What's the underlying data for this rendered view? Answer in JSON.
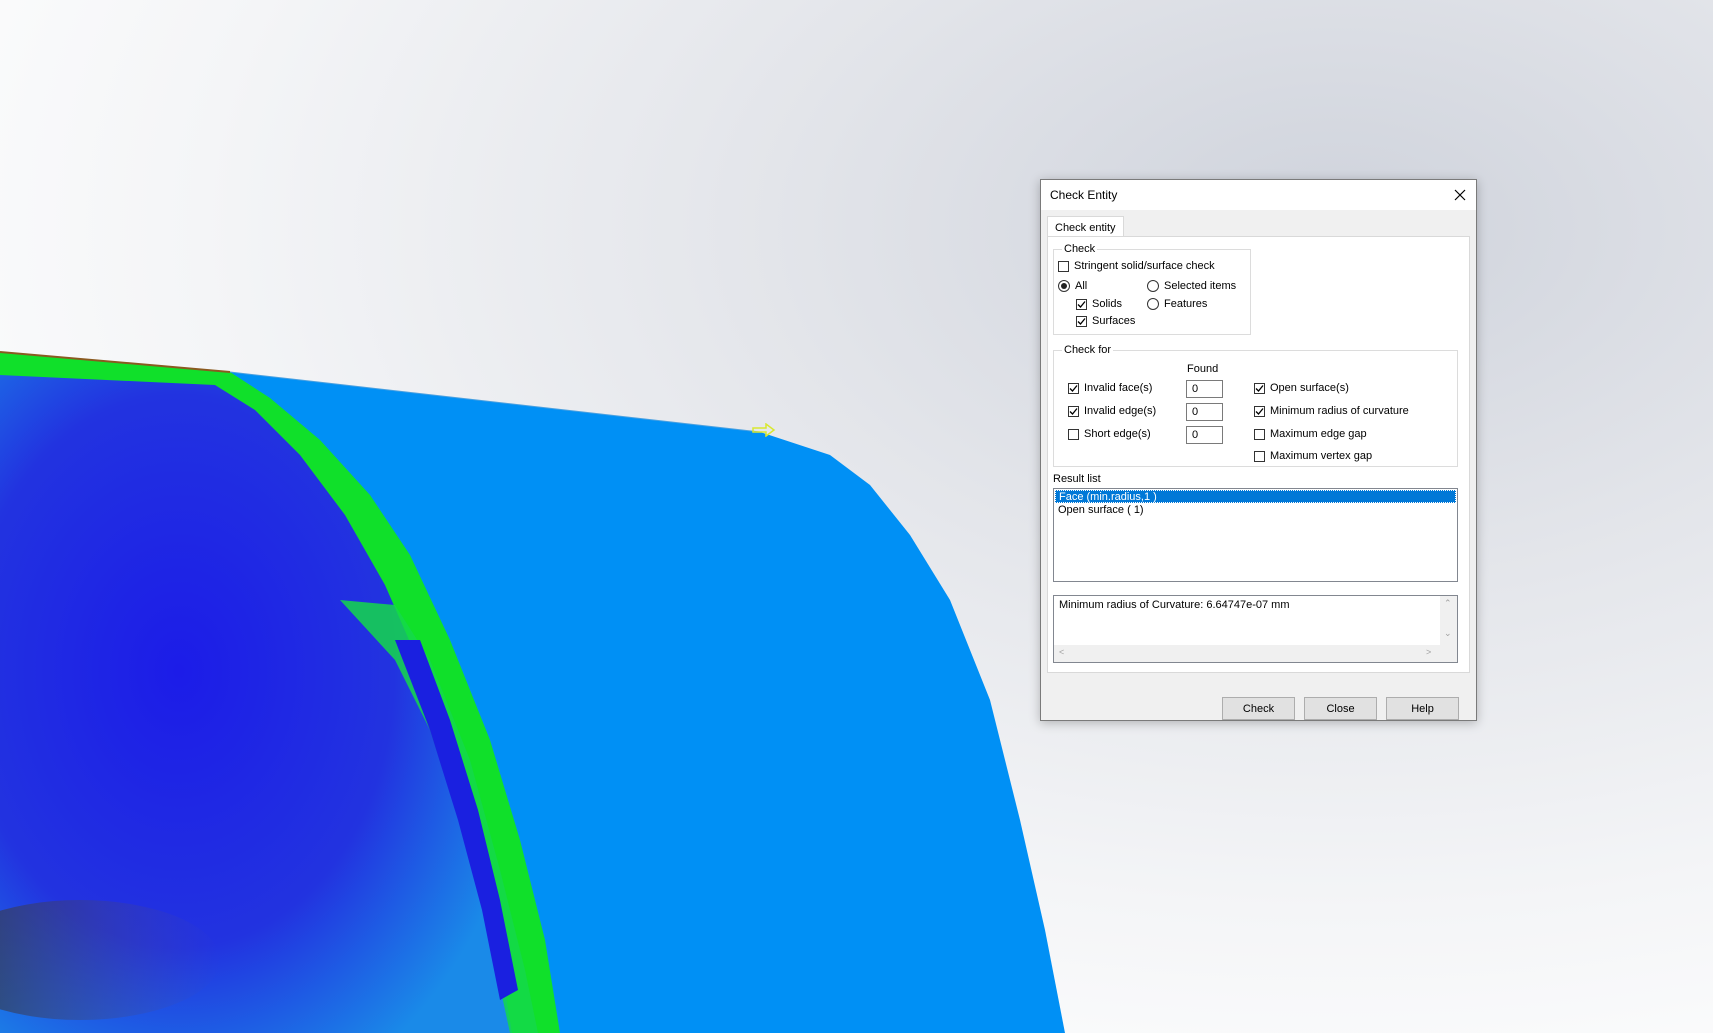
{
  "dialog": {
    "title": "Check Entity",
    "tab_label": "Check entity",
    "check_group": {
      "label": "Check",
      "stringent": {
        "label": "Stringent solid/surface check",
        "checked": false
      },
      "scope_all": {
        "label": "All",
        "selected": true
      },
      "scope_selected": {
        "label": "Selected items",
        "selected": false
      },
      "solids": {
        "label": "Solids",
        "checked": true
      },
      "features": {
        "label": "Features",
        "selected": false
      },
      "surfaces": {
        "label": "Surfaces",
        "checked": true
      }
    },
    "check_for": {
      "label": "Check for",
      "found_header": "Found",
      "left": [
        {
          "label": "Invalid face(s)",
          "checked": true,
          "found": "0"
        },
        {
          "label": "Invalid edge(s)",
          "checked": true,
          "found": "0"
        },
        {
          "label": "Short edge(s)",
          "checked": false,
          "found": "0"
        }
      ],
      "right": [
        {
          "label": "Open surface(s)",
          "checked": true
        },
        {
          "label": "Minimum radius of curvature",
          "checked": true
        },
        {
          "label": "Maximum edge gap",
          "checked": false
        },
        {
          "label": "Maximum vertex gap",
          "checked": false
        }
      ]
    },
    "result_list": {
      "label": "Result list",
      "items": [
        {
          "text": "Face (min.radius,1  )",
          "selected": true
        },
        {
          "text": "Open surface (  1)",
          "selected": false
        }
      ]
    },
    "message": "Minimum radius of Curvature: 6.64747e-07 mm",
    "buttons": {
      "check": "Check",
      "close": "Close",
      "help": "Help"
    }
  },
  "colors": {
    "surface_blue": "#0090f5",
    "curvature_green": "#10e02a",
    "curvature_deep_blue": "#1a1ae0",
    "selection_blue": "#0078d7"
  },
  "icons": [
    "close-icon",
    "check-mark-icon",
    "selection-arrow-icon",
    "scroll-up-icon",
    "scroll-down-icon",
    "scroll-left-icon",
    "scroll-right-icon"
  ]
}
